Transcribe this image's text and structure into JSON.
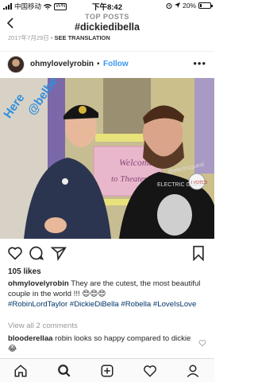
{
  "status_bar": {
    "carrier": "中国移动",
    "vpn": "VPN",
    "time": "下午8:42",
    "battery": "20%",
    "battery_level": 0.2
  },
  "header": {
    "subtitle": "TOP POSTS",
    "title": "#dickiedibella",
    "prev_date": "2017年7月29日",
    "prev_translate": "SEE TRANSLATION"
  },
  "post": {
    "username": "ohmylovelyrobin",
    "dot": "•",
    "follow_label": "Follow",
    "photo_sign": "Welcome to Theater!",
    "photo_sticker": "Here",
    "photo_sticker_2": "@belbe",
    "photo_shirt_text": "@electricguest",
    "photo_shirt_text_2": "ELECTRIC GUEST",
    "photo_badge": "I VOTED",
    "likes": "105 likes",
    "caption_user": "ohmylovelyrobin",
    "caption_text": " They are the cutest, the most beautiful couple in the world !!! 😍😍😍",
    "caption_tags": "#RobinLordTaylor #DickieDiBella #Robella #LoveIsLove",
    "view_all": "View all 2 comments",
    "comment_user": "blooderellaa",
    "comment_text": " robin looks so happy compared to dickie😂"
  },
  "nav": {
    "items": [
      "home-icon",
      "search-icon",
      "add-post-icon",
      "activity-heart-icon",
      "profile-icon"
    ]
  },
  "colors": {
    "accent": "#3897f0",
    "hashtag": "#003569",
    "muted": "#8e8e8e"
  }
}
